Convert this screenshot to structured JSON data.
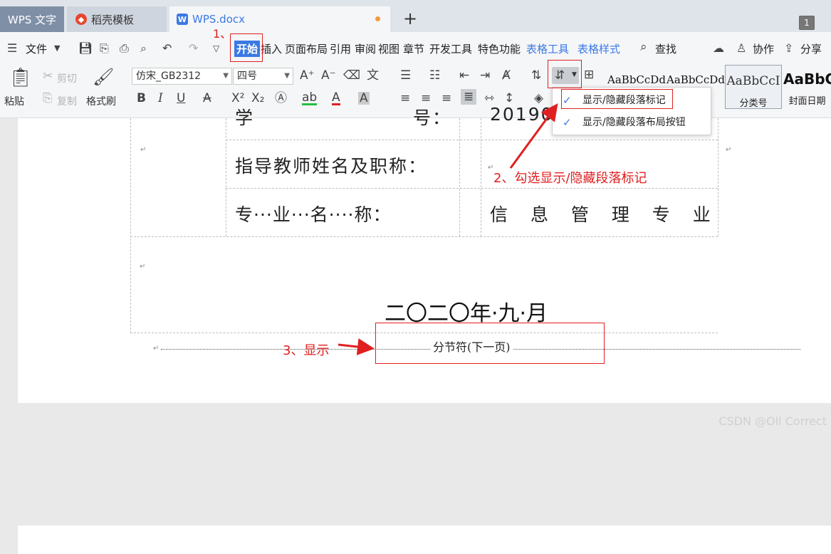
{
  "tabs": {
    "app": "WPS 文字",
    "template": "稻壳模板",
    "document": "WPS.docx",
    "new_tab": "+",
    "window_count": "1",
    "template_logo": "docer-logo-icon",
    "document_logo": "wps-doc-icon"
  },
  "menu": {
    "file": "文件",
    "items": [
      "开始",
      "插入",
      "页面布局",
      "引用",
      "审阅",
      "视图",
      "章节",
      "开发工具",
      "特色功能"
    ],
    "table_tools": "表格工具",
    "table_style": "表格样式",
    "search": "查找",
    "collaborate": "协作",
    "share": "分享"
  },
  "ribbon": {
    "paste": "粘贴",
    "cut": "剪切",
    "copy": "复制",
    "format_painter": "格式刷",
    "font_name": "仿宋_GB2312",
    "font_size": "四号",
    "bold": "B",
    "italic": "I",
    "underline": "U",
    "styles": [
      {
        "sample": "AaBbCcDd",
        "name": ""
      },
      {
        "sample": "AaBbCcDd",
        "name": "..."
      },
      {
        "sample": "AaBbCcI",
        "name": "分类号"
      },
      {
        "sample": "AaBbC",
        "name": "封面日期"
      }
    ]
  },
  "dropdown": {
    "items": [
      "显示/隐藏段落标记",
      "显示/隐藏段落布局按钮"
    ]
  },
  "annotations": {
    "step1": "1、",
    "step2": "2、勾选显示/隐藏段落标记",
    "step3": "3、显示"
  },
  "document": {
    "row1_label_left": "学",
    "row1_label_right": "号：",
    "row1_value": "201904",
    "advisor_label": "指导教师姓名及职称：",
    "major_label": "专···业···名····称：",
    "major_value": "信 息 管 理 专 业",
    "date": "二〇二〇年·九·月",
    "section_break": "分节符(下一页)"
  },
  "watermark": "CSDN @Oll Correct"
}
